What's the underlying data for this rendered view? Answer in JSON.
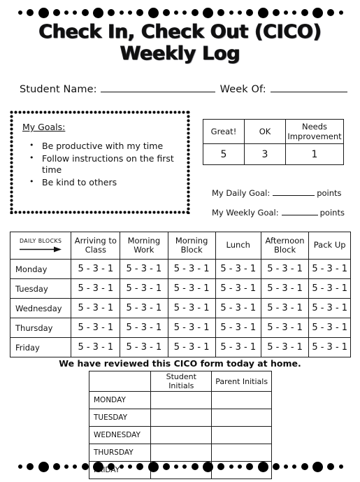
{
  "title": {
    "line1": "Check In, Check Out (CICO)",
    "line2": "Weekly Log"
  },
  "header_fields": {
    "student_name_label": "Student Name:",
    "week_of_label": "Week Of:"
  },
  "goals_box": {
    "heading": "My Goals:",
    "items": [
      "Be productive with my time",
      "Follow instructions on the first time",
      "Be kind to others"
    ]
  },
  "scoring_key": {
    "labels": [
      "Great!",
      "OK",
      "Needs Improvement"
    ],
    "values": [
      "5",
      "3",
      "1"
    ]
  },
  "goal_targets": {
    "daily_prefix": "My Daily Goal:",
    "daily_suffix": "points",
    "weekly_prefix": "My Weekly Goal:",
    "weekly_suffix": "points"
  },
  "blocks_table": {
    "corner_label": "DAILY BLOCKS",
    "corner_icon": "right-arrow-icon",
    "columns": [
      "Arriving to Class",
      "Morning Work",
      "Morning Block",
      "Lunch",
      "Afternoon Block",
      "Pack Up"
    ],
    "days": [
      "Monday",
      "Tuesday",
      "Wednesday",
      "Thursday",
      "Friday"
    ],
    "cell_value": "5 - 3 - 1"
  },
  "review": {
    "statement": "We have reviewed this CICO form today at home.",
    "columns": [
      "",
      "Student Initials",
      "Parent Initials"
    ],
    "days": [
      "MONDAY",
      "TUESDAY",
      "WEDNESDAY",
      "THURSDAY",
      "FRIDAY"
    ]
  },
  "decor": {
    "dot_pattern": [
      "s",
      "m",
      "l",
      "m",
      "s"
    ],
    "dot_color": "#000000"
  },
  "colors": {
    "ink": "#111111",
    "rule": "#1a1a1a",
    "page_background": "#ffffff"
  }
}
